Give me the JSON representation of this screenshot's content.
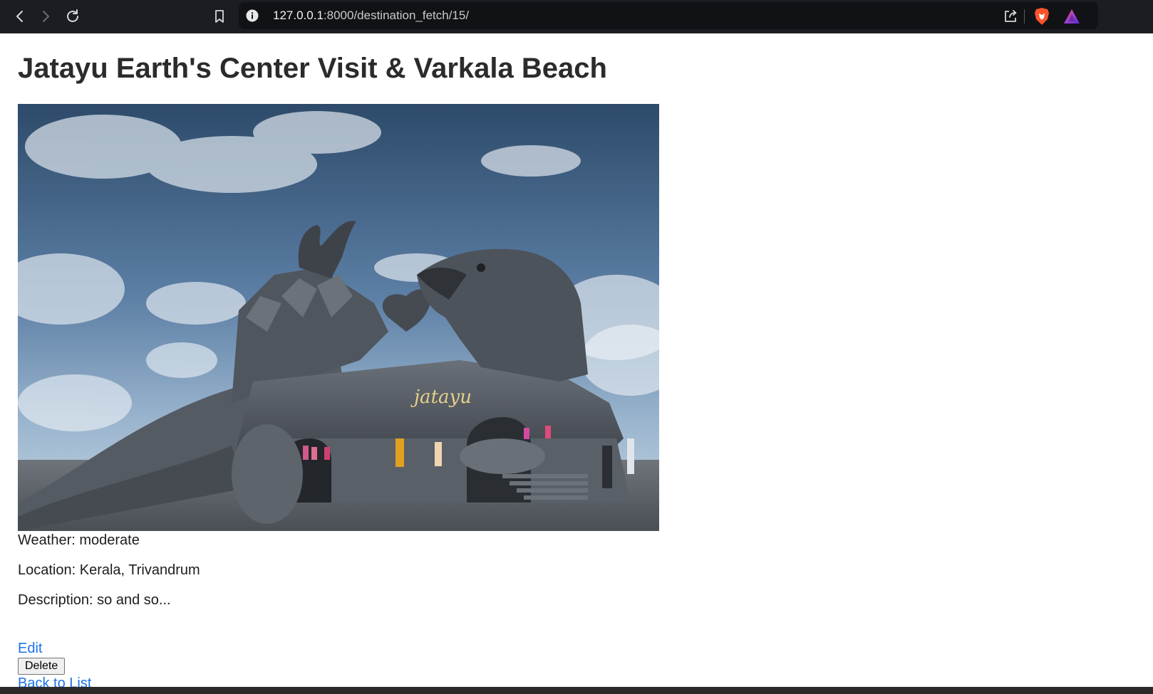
{
  "browser": {
    "url_host": "127.0.0.1",
    "url_rest": ":8000/destination_fetch/15/",
    "icons": {
      "back": "back-arrow-icon",
      "forward": "forward-arrow-icon",
      "reload": "reload-icon",
      "bookmark": "bookmark-icon",
      "site_info": "info-icon",
      "share": "share-icon",
      "brave": "brave-shields-icon",
      "rewards": "brave-rewards-icon"
    }
  },
  "destination": {
    "title": "Jatayu Earth's Center Visit & Varkala Beach",
    "photo_label": "jatayu",
    "weather": "Weather: moderate",
    "location": "Location: Kerala, Trivandrum",
    "description": "Description: so and so..."
  },
  "actions": {
    "edit": "Edit",
    "delete": "Delete",
    "back": "Back to List"
  },
  "colors": {
    "link": "#1a73e8",
    "toolbar": "#1c1d22",
    "brave_orange": "#fb542b"
  }
}
